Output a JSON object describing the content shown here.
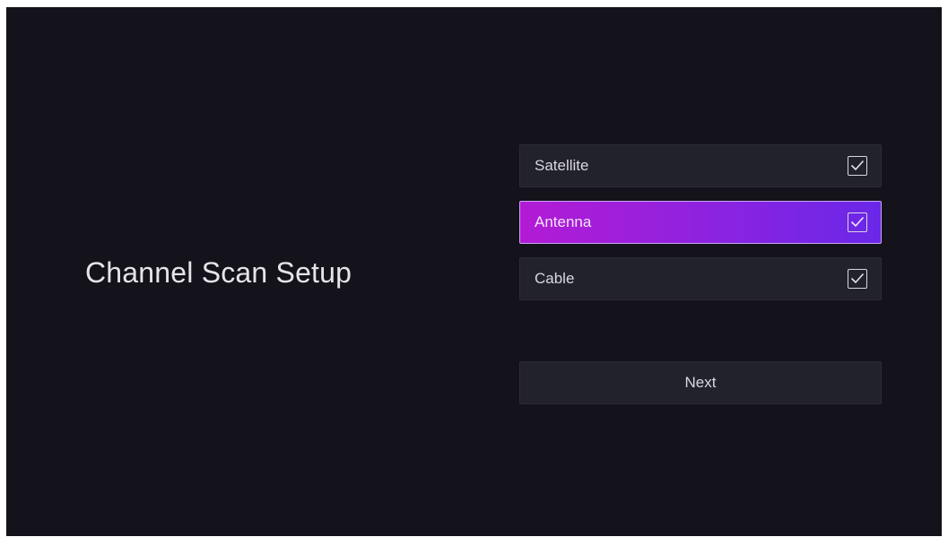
{
  "screen": {
    "title": "Channel Scan Setup"
  },
  "options": [
    {
      "label": "Satellite",
      "checked": true,
      "focused": false,
      "icon": "checkbox-checked-icon"
    },
    {
      "label": "Antenna",
      "checked": true,
      "focused": true,
      "icon": "checkbox-checked-icon"
    },
    {
      "label": "Cable",
      "checked": true,
      "focused": false,
      "icon": "checkbox-checked-icon"
    }
  ],
  "actions": {
    "next_label": "Next"
  },
  "colors": {
    "background": "#14121a",
    "tile": "#22222c",
    "focus_gradient_start": "#b31bd4",
    "focus_gradient_end": "#6a27e8",
    "text": "#d9d8de"
  }
}
